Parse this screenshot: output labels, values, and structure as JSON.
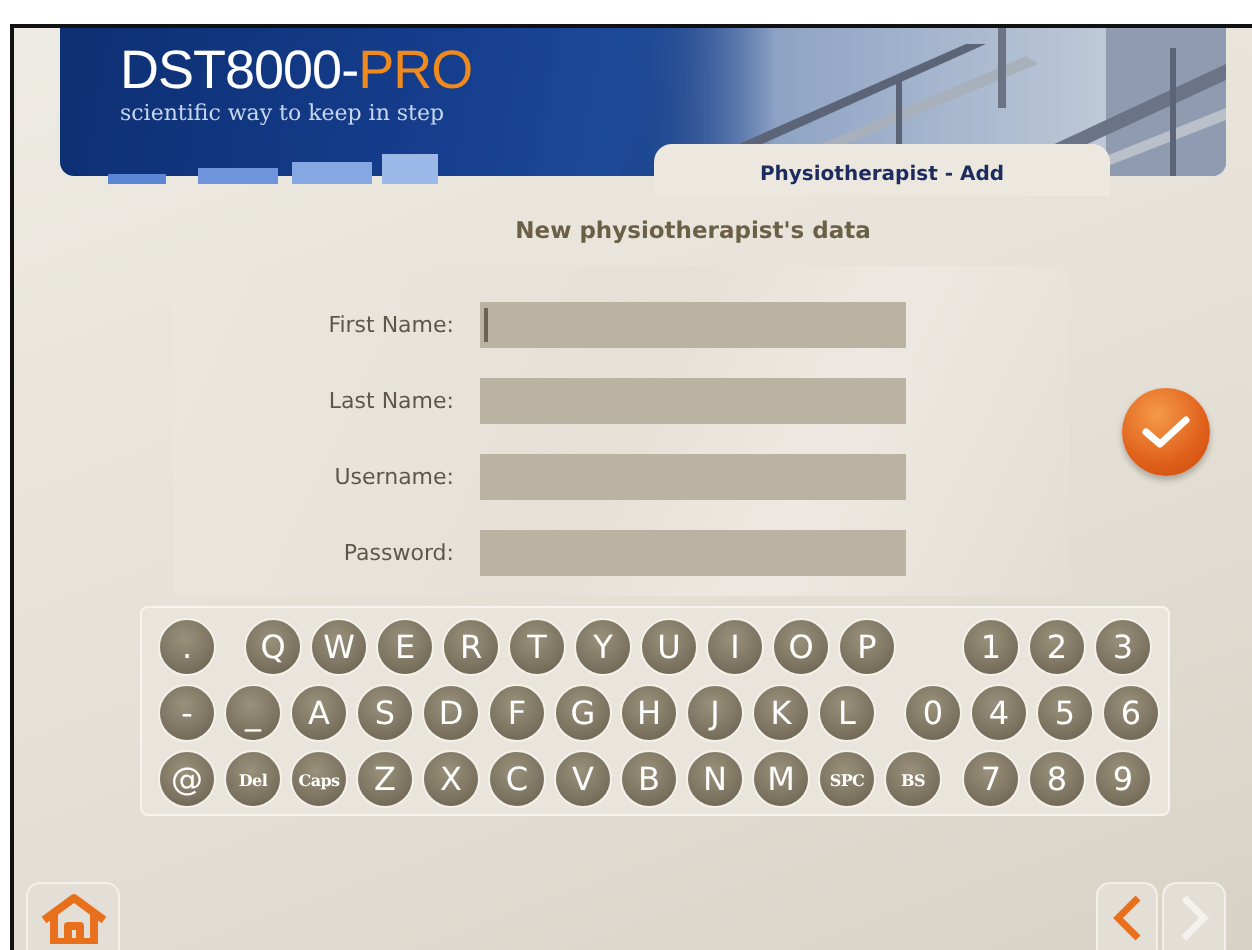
{
  "header": {
    "logo": {
      "text": "DST8000-",
      "accent": "PRO"
    },
    "tagline": "scientific way to keep in step",
    "tab": "Physiotherapist - Add"
  },
  "title": "New physiotherapist's data",
  "form": {
    "fields": [
      {
        "label": "First Name:",
        "focused": true
      },
      {
        "label": "Last Name:",
        "focused": false
      },
      {
        "label": "Username:",
        "focused": false
      },
      {
        "label": "Password:",
        "focused": false
      }
    ]
  },
  "keyboard": {
    "rows": [
      {
        "keys": [
          {
            "kind": "key",
            "label": "."
          },
          {
            "kind": "gap"
          },
          {
            "kind": "key",
            "label": "Q"
          },
          {
            "kind": "key",
            "label": "W"
          },
          {
            "kind": "key",
            "label": "E"
          },
          {
            "kind": "key",
            "label": "R"
          },
          {
            "kind": "key",
            "label": "T"
          },
          {
            "kind": "key",
            "label": "Y"
          },
          {
            "kind": "key",
            "label": "U"
          },
          {
            "kind": "key",
            "label": "I"
          },
          {
            "kind": "key",
            "label": "O"
          },
          {
            "kind": "key",
            "label": "P"
          }
        ],
        "digits": [
          "1",
          "2",
          "3"
        ]
      },
      {
        "keys": [
          {
            "kind": "key",
            "label": "-"
          },
          {
            "kind": "key",
            "label": "_"
          },
          {
            "kind": "key",
            "label": "A"
          },
          {
            "kind": "key",
            "label": "S"
          },
          {
            "kind": "key",
            "label": "D"
          },
          {
            "kind": "key",
            "label": "F"
          },
          {
            "kind": "key",
            "label": "G"
          },
          {
            "kind": "key",
            "label": "H"
          },
          {
            "kind": "key",
            "label": "J"
          },
          {
            "kind": "key",
            "label": "K"
          },
          {
            "kind": "key",
            "label": "L"
          },
          {
            "kind": "gap"
          },
          {
            "kind": "key",
            "label": "0"
          }
        ],
        "digits": [
          "4",
          "5",
          "6"
        ]
      },
      {
        "keys": [
          {
            "kind": "key",
            "label": "@"
          },
          {
            "kind": "small",
            "label": "Del"
          },
          {
            "kind": "small",
            "label": "Caps"
          },
          {
            "kind": "key",
            "label": "Z"
          },
          {
            "kind": "key",
            "label": "X"
          },
          {
            "kind": "key",
            "label": "C"
          },
          {
            "kind": "key",
            "label": "V"
          },
          {
            "kind": "key",
            "label": "B"
          },
          {
            "kind": "key",
            "label": "N"
          },
          {
            "kind": "key",
            "label": "M"
          },
          {
            "kind": "small",
            "label": "SPC"
          },
          {
            "kind": "small",
            "label": "BS"
          }
        ],
        "digits": [
          "7",
          "8",
          "9"
        ]
      }
    ]
  },
  "nav": {
    "prev_disabled": false,
    "next_disabled": true
  }
}
